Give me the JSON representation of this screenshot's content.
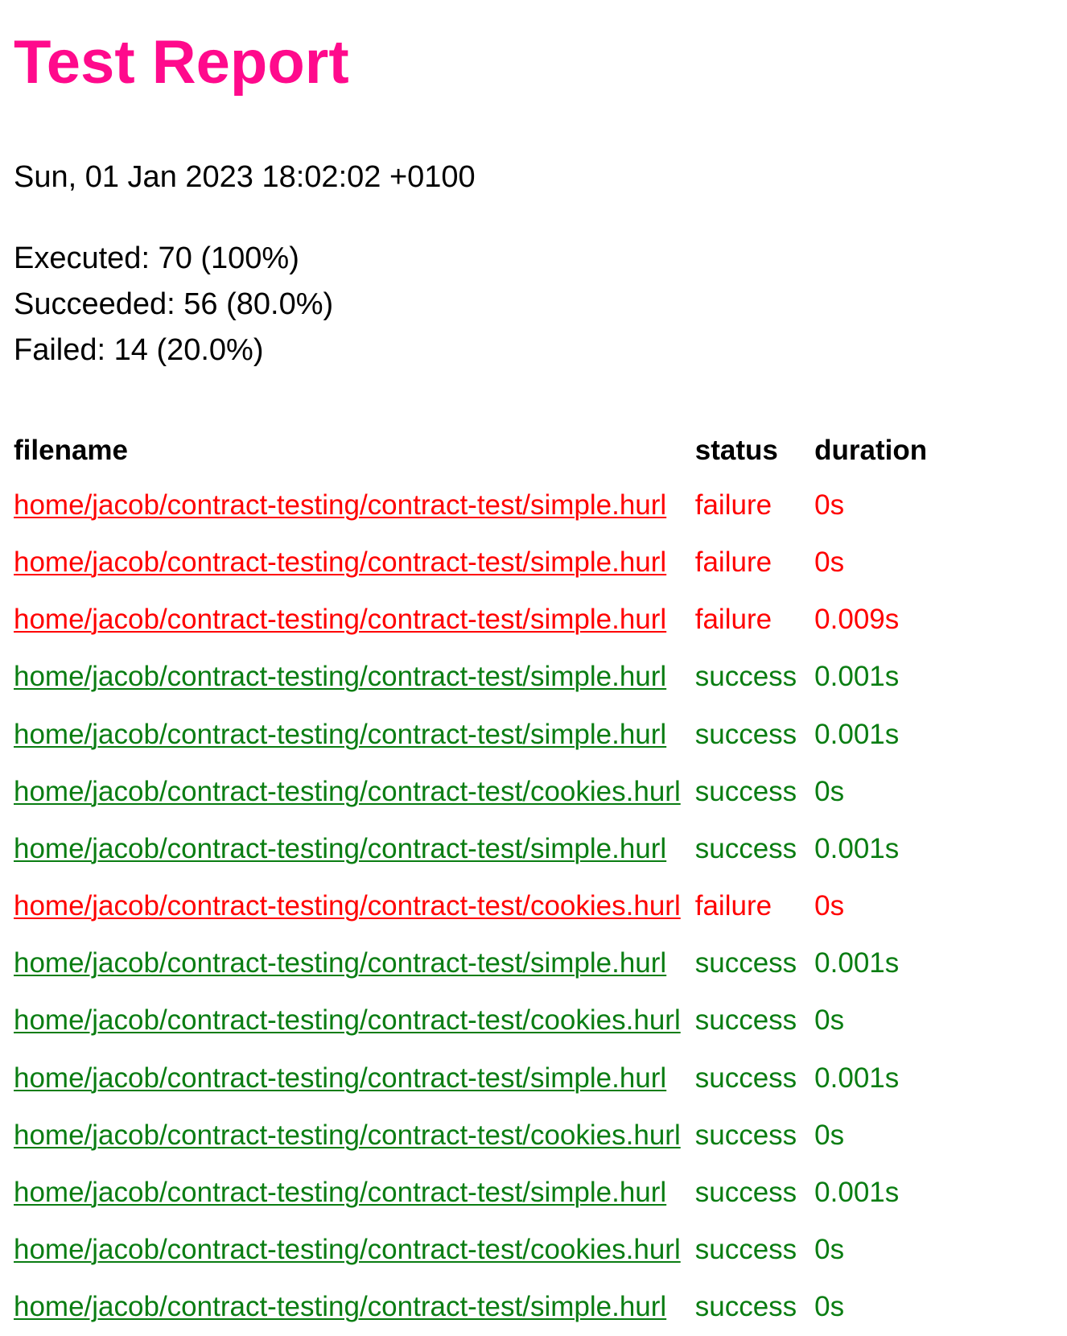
{
  "title": "Test Report",
  "colors": {
    "title": "#ff0a8c",
    "success": "#0a7d12",
    "failure": "#ff0000"
  },
  "date": "Sun, 01 Jan 2023 18:02:02 +0100",
  "summary": {
    "executed": "Executed: 70 (100%)",
    "succeeded": "Succeeded: 56 (80.0%)",
    "failed": "Failed: 14 (20.0%)"
  },
  "table": {
    "headers": {
      "filename": "filename",
      "status": "status",
      "duration": "duration"
    },
    "rows": [
      {
        "filename": "home/jacob/contract-testing/contract-test/simple.hurl",
        "status": "failure",
        "duration": "0s"
      },
      {
        "filename": "home/jacob/contract-testing/contract-test/simple.hurl",
        "status": "failure",
        "duration": "0s"
      },
      {
        "filename": "home/jacob/contract-testing/contract-test/simple.hurl",
        "status": "failure",
        "duration": "0.009s"
      },
      {
        "filename": "home/jacob/contract-testing/contract-test/simple.hurl",
        "status": "success",
        "duration": "0.001s"
      },
      {
        "filename": "home/jacob/contract-testing/contract-test/simple.hurl",
        "status": "success",
        "duration": "0.001s"
      },
      {
        "filename": "home/jacob/contract-testing/contract-test/cookies.hurl",
        "status": "success",
        "duration": "0s"
      },
      {
        "filename": "home/jacob/contract-testing/contract-test/simple.hurl",
        "status": "success",
        "duration": "0.001s"
      },
      {
        "filename": "home/jacob/contract-testing/contract-test/cookies.hurl",
        "status": "failure",
        "duration": "0s"
      },
      {
        "filename": "home/jacob/contract-testing/contract-test/simple.hurl",
        "status": "success",
        "duration": "0.001s"
      },
      {
        "filename": "home/jacob/contract-testing/contract-test/cookies.hurl",
        "status": "success",
        "duration": "0s"
      },
      {
        "filename": "home/jacob/contract-testing/contract-test/simple.hurl",
        "status": "success",
        "duration": "0.001s"
      },
      {
        "filename": "home/jacob/contract-testing/contract-test/cookies.hurl",
        "status": "success",
        "duration": "0s"
      },
      {
        "filename": "home/jacob/contract-testing/contract-test/simple.hurl",
        "status": "success",
        "duration": "0.001s"
      },
      {
        "filename": "home/jacob/contract-testing/contract-test/cookies.hurl",
        "status": "success",
        "duration": "0s"
      },
      {
        "filename": "home/jacob/contract-testing/contract-test/simple.hurl",
        "status": "success",
        "duration": "0s"
      }
    ]
  }
}
